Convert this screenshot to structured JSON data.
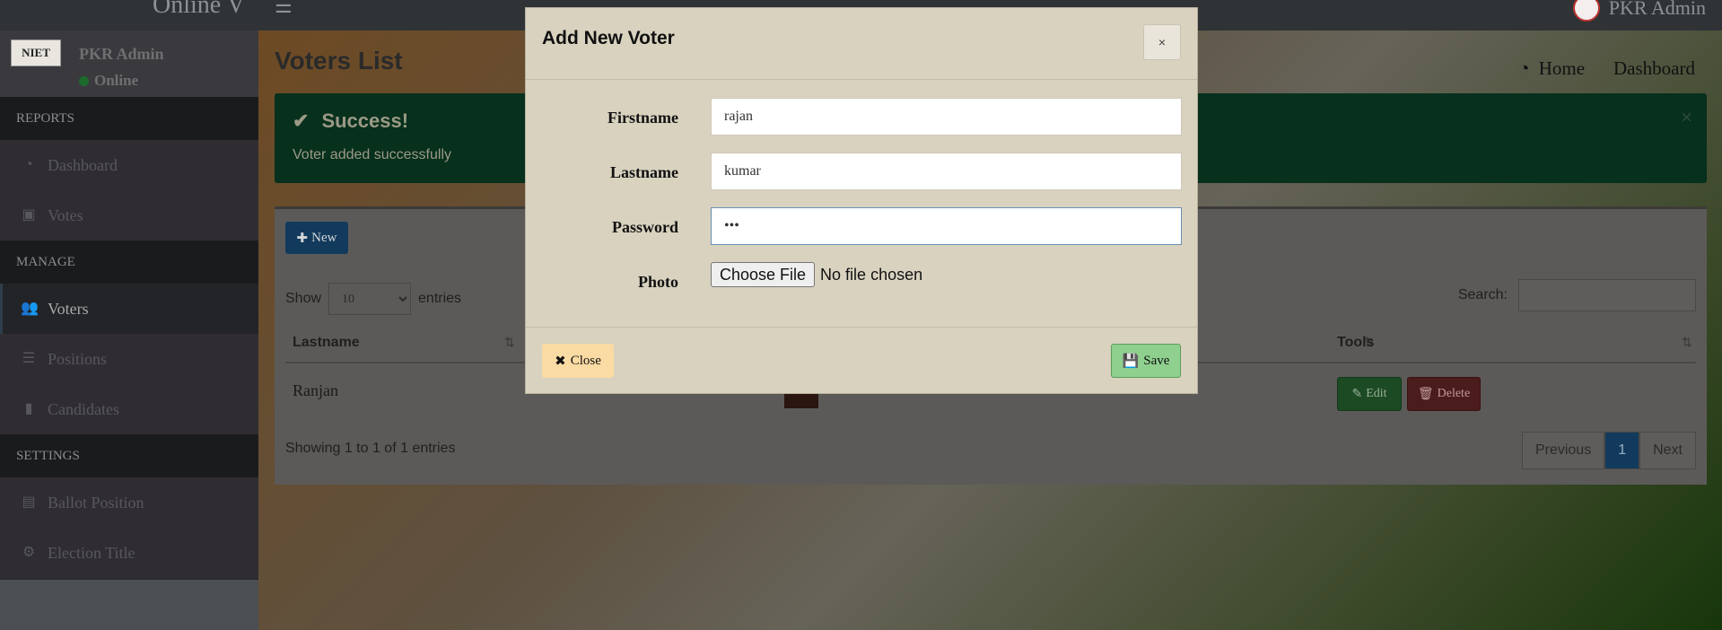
{
  "topbar": {
    "brand": "Online V",
    "user_name": "PKR Admin"
  },
  "sidebar": {
    "logo_text": "NIET",
    "user_name": "PKR Admin",
    "status": "Online",
    "sections": [
      {
        "header": "REPORTS",
        "items": [
          {
            "label": "Dashboard",
            "icon": "dashboard-icon"
          },
          {
            "label": "Votes",
            "icon": "lock-icon"
          }
        ]
      },
      {
        "header": "MANAGE",
        "items": [
          {
            "label": "Voters",
            "icon": "users-icon"
          },
          {
            "label": "Positions",
            "icon": "list-icon"
          },
          {
            "label": "Candidates",
            "icon": "badge-icon"
          }
        ]
      },
      {
        "header": "SETTINGS",
        "items": [
          {
            "label": "Ballot Position",
            "icon": "file-icon"
          },
          {
            "label": "Election Title",
            "icon": "cogs-icon"
          }
        ]
      }
    ],
    "active": "Voters"
  },
  "page": {
    "title": "Voters List",
    "breadcrumb": {
      "home": "Home",
      "current": "Dashboard"
    }
  },
  "alert": {
    "title": "Success!",
    "message": "Voter added successfully",
    "close": "×"
  },
  "table": {
    "new_button": "New",
    "show_label": "Show",
    "entries_value": "10",
    "entries_label": "entries",
    "search_label": "Search:",
    "columns": [
      "Lastname",
      "Tools"
    ],
    "rows": [
      {
        "lastname": "Ranjan"
      }
    ],
    "edit_label": "Edit",
    "delete_label": "Delete",
    "info": "Showing 1 to 1 of 1 entries",
    "pagination": {
      "previous": "Previous",
      "current": "1",
      "next": "Next"
    }
  },
  "modal": {
    "title": "Add New Voter",
    "close_x": "×",
    "fields": {
      "firstname": {
        "label": "Firstname",
        "value": "rajan"
      },
      "lastname": {
        "label": "Lastname",
        "value": "kumar"
      },
      "password": {
        "label": "Password",
        "value": "•••"
      },
      "photo": {
        "label": "Photo",
        "button": "Choose File",
        "status": "No file chosen"
      }
    },
    "close_button": "Close",
    "save_button": "Save"
  },
  "colors": {
    "alert_bg": "#07301d",
    "primary": "#123a5c",
    "save": "#8fd08f",
    "close": "#fbdba4"
  }
}
